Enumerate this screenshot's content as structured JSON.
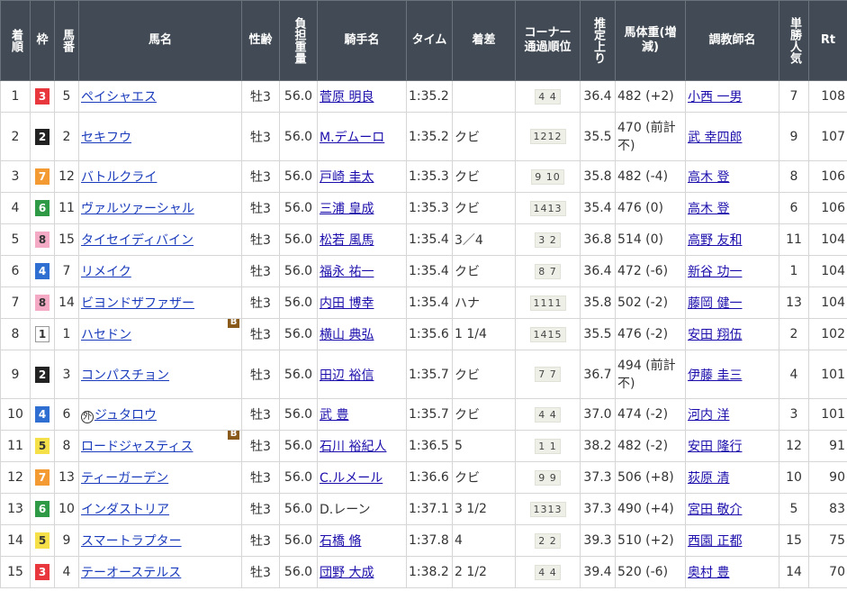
{
  "headers": {
    "rank": "着順",
    "waku": "枠",
    "num": "馬番",
    "horse": "馬名",
    "sexage": "性齢",
    "load": "負担重量",
    "jockey": "騎手名",
    "time": "タイム",
    "margin": "着差",
    "corner": "コーナー通過順位",
    "agari": "推定上り",
    "weight": "馬体重(増減)",
    "trainer": "調教師名",
    "pop": "単勝人気",
    "rt": "Rt"
  },
  "rows": [
    {
      "rank": "1",
      "waku": "3",
      "num": "5",
      "horse": "ペイシャエス",
      "sexage": "牡3",
      "load": "56.0",
      "jockey": "菅原 明良",
      "time": "1:35.2",
      "margin": "",
      "corner": "4 4",
      "agari": "36.4",
      "weight": "482 (+2)",
      "trainer": "小西 一男",
      "pop": "7",
      "rt": "108"
    },
    {
      "rank": "2",
      "waku": "2",
      "num": "2",
      "horse": "セキフウ",
      "sexage": "牡3",
      "load": "56.0",
      "jockey": "M.デムーロ",
      "time": "1:35.2",
      "margin": "クビ",
      "corner": "1212",
      "agari": "35.5",
      "weight": "470 (前計不)",
      "trainer": "武 幸四郎",
      "pop": "9",
      "rt": "107"
    },
    {
      "rank": "3",
      "waku": "7",
      "num": "12",
      "horse": "バトルクライ",
      "sexage": "牡3",
      "load": "56.0",
      "jockey": "戸崎 圭太",
      "time": "1:35.3",
      "margin": "クビ",
      "corner": "9 10",
      "agari": "35.8",
      "weight": "482 (-4)",
      "trainer": "高木 登",
      "pop": "8",
      "rt": "106"
    },
    {
      "rank": "4",
      "waku": "6",
      "num": "11",
      "horse": "ヴァルツァーシャル",
      "sexage": "牡3",
      "load": "56.0",
      "jockey": "三浦 皇成",
      "time": "1:35.3",
      "margin": "クビ",
      "corner": "1413",
      "agari": "35.4",
      "weight": "476 (0)",
      "trainer": "高木 登",
      "pop": "6",
      "rt": "106"
    },
    {
      "rank": "5",
      "waku": "8",
      "num": "15",
      "horse": "タイセイディバイン",
      "sexage": "牡3",
      "load": "56.0",
      "jockey": "松若 風馬",
      "time": "1:35.4",
      "margin": "3／4",
      "corner": "3 2",
      "agari": "36.8",
      "weight": "514 (0)",
      "trainer": "高野 友和",
      "pop": "11",
      "rt": "104"
    },
    {
      "rank": "6",
      "waku": "4",
      "num": "7",
      "horse": "リメイク",
      "sexage": "牡3",
      "load": "56.0",
      "jockey": "福永 祐一",
      "time": "1:35.4",
      "margin": "クビ",
      "corner": "8 7",
      "agari": "36.4",
      "weight": "472 (-6)",
      "trainer": "新谷 功一",
      "pop": "1",
      "rt": "104"
    },
    {
      "rank": "7",
      "waku": "8",
      "num": "14",
      "horse": "ビヨンドザファザー",
      "sexage": "牡3",
      "load": "56.0",
      "jockey": "内田 博幸",
      "time": "1:35.4",
      "margin": "ハナ",
      "corner": "1111",
      "agari": "35.8",
      "weight": "502 (-2)",
      "trainer": "藤岡 健一",
      "pop": "13",
      "rt": "104"
    },
    {
      "rank": "8",
      "waku": "1",
      "num": "1",
      "horse": "ハセドン",
      "sexage": "牡3",
      "load": "56.0",
      "jockey": "横山 典弘",
      "time": "1:35.6",
      "margin": "1 1/4",
      "corner": "1415",
      "agari": "35.5",
      "weight": "476 (-2)",
      "trainer": "安田 翔伍",
      "pop": "2",
      "rt": "102",
      "blinker": "B"
    },
    {
      "rank": "9",
      "waku": "2",
      "num": "3",
      "horse": "コンパスチョン",
      "sexage": "牡3",
      "load": "56.0",
      "jockey": "田辺 裕信",
      "time": "1:35.7",
      "margin": "クビ",
      "corner": "7 7",
      "agari": "36.7",
      "weight": "494 (前計不)",
      "trainer": "伊藤 圭三",
      "pop": "4",
      "rt": "101"
    },
    {
      "rank": "10",
      "waku": "4",
      "num": "6",
      "horse": "ジュタロウ",
      "sexage": "牡3",
      "load": "56.0",
      "jockey": "武 豊",
      "time": "1:35.7",
      "margin": "クビ",
      "corner": "4 4",
      "agari": "37.0",
      "weight": "474 (-2)",
      "trainer": "河内 洋",
      "pop": "3",
      "rt": "101",
      "gai": "外"
    },
    {
      "rank": "11",
      "waku": "5",
      "num": "8",
      "horse": "ロードジャスティス",
      "sexage": "牡3",
      "load": "56.0",
      "jockey": "石川 裕紀人",
      "time": "1:36.5",
      "margin": "5",
      "corner": "1 1",
      "agari": "38.2",
      "weight": "482 (-2)",
      "trainer": "安田 隆行",
      "pop": "12",
      "rt": "91",
      "blinker": "B"
    },
    {
      "rank": "12",
      "waku": "7",
      "num": "13",
      "horse": "ティーガーデン",
      "sexage": "牡3",
      "load": "56.0",
      "jockey": "C.ルメール",
      "time": "1:36.6",
      "margin": "クビ",
      "corner": "9 9",
      "agari": "37.3",
      "weight": "506 (+8)",
      "trainer": "荻原 清",
      "pop": "10",
      "rt": "90"
    },
    {
      "rank": "13",
      "waku": "6",
      "num": "10",
      "horse": "インダストリア",
      "sexage": "牡3",
      "load": "56.0",
      "jockey": "D.レーン",
      "time": "1:37.1",
      "margin": "3 1/2",
      "corner": "1313",
      "agari": "37.3",
      "weight": "490 (+4)",
      "trainer": "宮田 敬介",
      "pop": "5",
      "rt": "83",
      "nolink": true
    },
    {
      "rank": "14",
      "waku": "5",
      "num": "9",
      "horse": "スマートラプター",
      "sexage": "牡3",
      "load": "56.0",
      "jockey": "石橋 脩",
      "time": "1:37.8",
      "margin": "4",
      "corner": "2 2",
      "agari": "39.3",
      "weight": "510 (+2)",
      "trainer": "西園 正都",
      "pop": "15",
      "rt": "75"
    },
    {
      "rank": "15",
      "waku": "3",
      "num": "4",
      "horse": "テーオーステルス",
      "sexage": "牡3",
      "load": "56.0",
      "jockey": "団野 大成",
      "time": "1:38.2",
      "margin": "2 1/2",
      "corner": "4 4",
      "agari": "39.4",
      "weight": "520 (-6)",
      "trainer": "奥村 豊",
      "pop": "14",
      "rt": "70"
    }
  ]
}
